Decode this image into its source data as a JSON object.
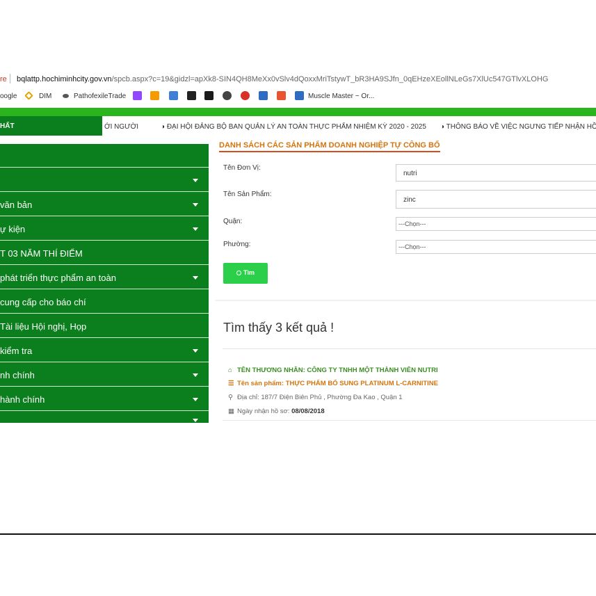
{
  "browser": {
    "url_protocol": "re",
    "url_host": "bqlattp.hochiminhcity.gov.vn",
    "url_path": "/spcb.aspx?c=19&gidzl=apXk8-SIN4QH8MeXx0vSlv4dQoxxMriTstywT_bR3HA9SJfn_0qEHzeXEollNLeGs7XlUc547GTlvXLOHG",
    "bookmarks": [
      "oogle",
      "DIM",
      "PathofexileTrade",
      "Muscle Master ~ Or..."
    ]
  },
  "ticker": {
    "tab_label": "HẤT",
    "items": [
      "ỚI NGƯỜI",
      "◑ ĐẠI HỘI ĐẢNG BỘ BAN QUẢN LÝ AN TOÀN THỰC PHẨM NHIỆM KỲ 2020 - 2025",
      "◑ THÔNG BÁO VỀ VIỆC NGƯNG TIẾP NHẬN HỒ"
    ]
  },
  "sidebar": {
    "items": [
      {
        "label": ""
      },
      {
        "label": ""
      },
      {
        "label": "văn bản"
      },
      {
        "label": "ự kiện"
      },
      {
        "label": "T 03 NĂM THÍ ĐIỂM"
      },
      {
        "label": " phát triển thực phẩm an toàn"
      },
      {
        "label": "cung cấp cho báo chí"
      },
      {
        "label": " Tài liệu Hội nghị, Họp"
      },
      {
        "label": " kiểm tra"
      },
      {
        "label": "nh chính"
      },
      {
        "label": "hành chính"
      },
      {
        "label": ""
      }
    ]
  },
  "search": {
    "title": "DANH SÁCH CÁC SẢN PHẨM DOANH NGHIỆP TỰ CÔNG BỐ",
    "fields": {
      "unit_label": "Tên Đơn Vị:",
      "unit_value": "nutri",
      "product_label": "Tên Sản Phẩm:",
      "product_value": "zinc",
      "district_label": "Quận:",
      "district_value": "---Chọn---",
      "ward_label": "Phường:",
      "ward_value": "---Chọn---"
    },
    "button_label": "Tìm"
  },
  "results": {
    "count_text": "Tìm thấy 3 kết quả !",
    "items": [
      {
        "merchant": "TÊN THƯƠNG NHÂN: CÔNG TY TNHH MỘT THÀNH VIÊN NUTRI",
        "product": "Tên sản phẩm: THỰC PHẨM BỔ SUNG PLATINUM L-CARNITINE",
        "address": "Địa chỉ: 187/7 Điện Biên Phủ , Phường Đa Kao , Quận 1",
        "date_label": "Ngày nhận hồ sơ:",
        "date_value": "08/08/2018"
      }
    ]
  },
  "colors": {
    "sidebar_green": "#0b7f1d",
    "top_bar_green": "#2bb51c",
    "button_green": "#2bcf4a",
    "accent_orange": "#d4740f"
  }
}
